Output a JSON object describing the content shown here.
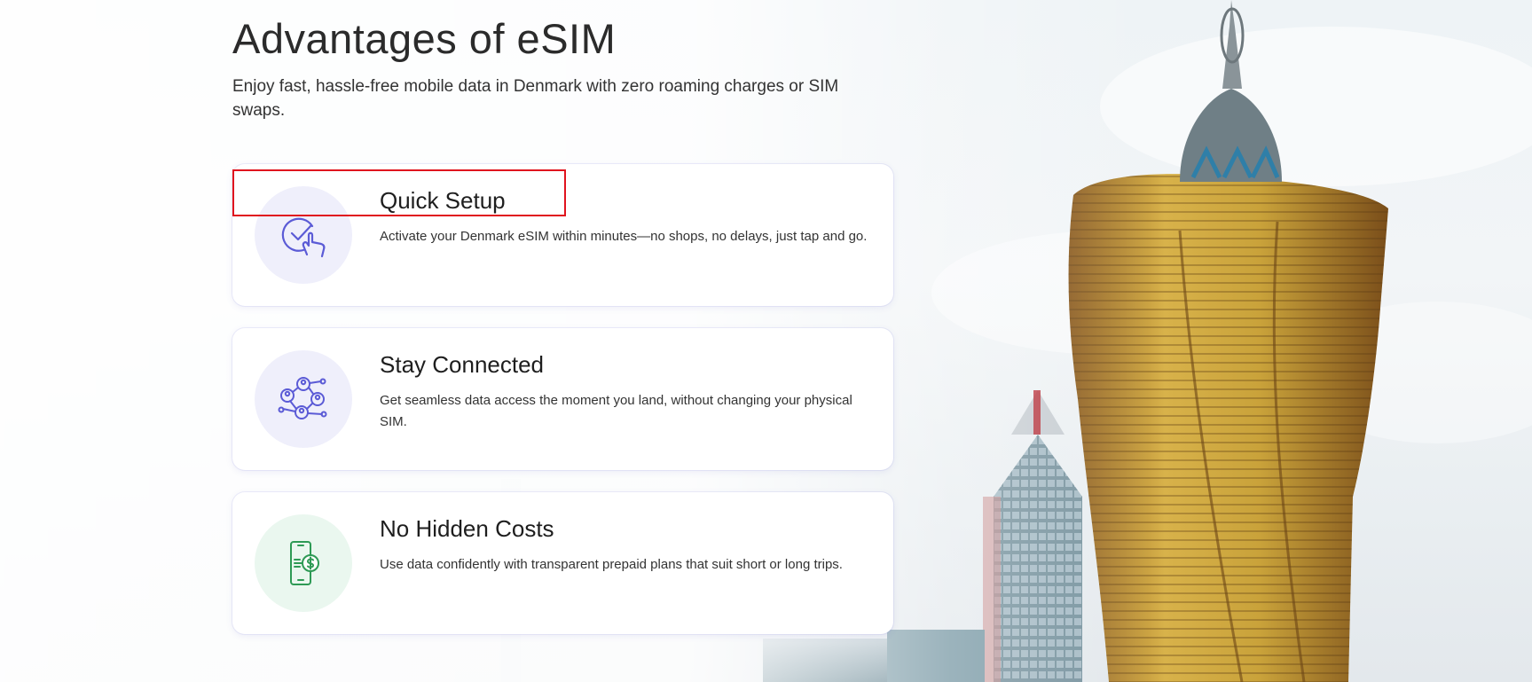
{
  "section": {
    "title": "Advantages of eSIM",
    "subtitle": "Enjoy fast, hassle-free mobile data in Denmark with zero roaming charges or SIM swaps."
  },
  "cards": [
    {
      "title": "Quick Setup",
      "description": "Activate your Denmark eSIM within minutes—no shops, no delays, just tap and go.",
      "icon": "touch-check-icon",
      "accent": "#5b5bd6"
    },
    {
      "title": "Stay Connected",
      "description": "Get seamless data access the moment you land, without changing your physical SIM.",
      "icon": "network-people-icon",
      "accent": "#5b5bd6"
    },
    {
      "title": "No Hidden Costs",
      "description": "Use data confidently with transparent prepaid plans that suit short or long trips.",
      "icon": "phone-dollar-icon",
      "accent": "#2e9a55"
    }
  ],
  "colors": {
    "highlight": "#e0141e",
    "icon_bg_purple": "#efeffb",
    "icon_bg_green": "#eaf7ef",
    "tower_gold": "#c9a23a"
  }
}
